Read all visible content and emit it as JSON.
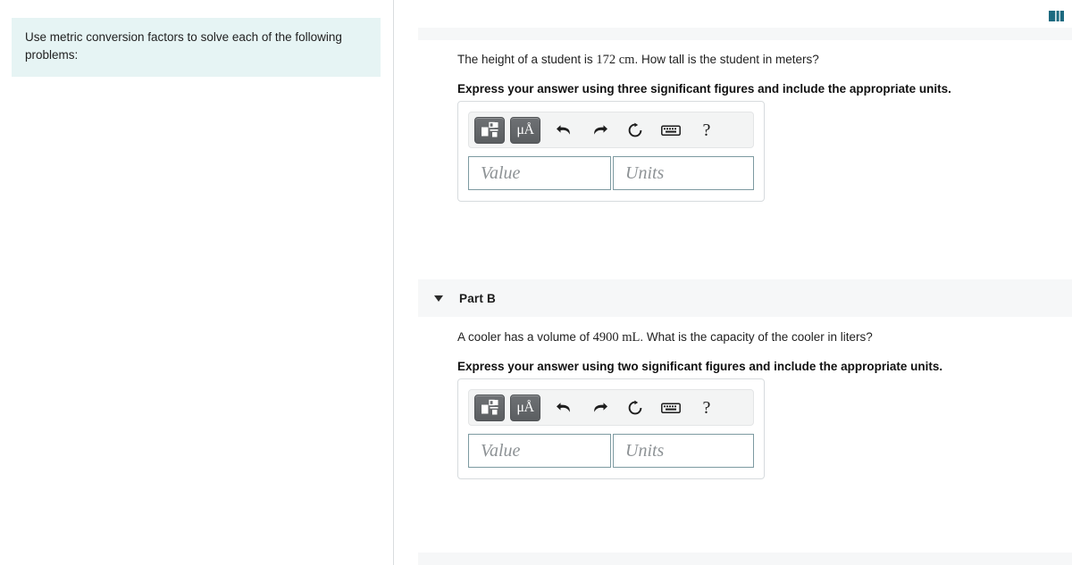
{
  "left_pane": {
    "prompt": "Use metric conversion factors to solve each of the following problems:"
  },
  "corner": {
    "icon": "panel-layout-icon",
    "color": "#1d6a80"
  },
  "parts": [
    {
      "id": "part-a",
      "header_label": "",
      "has_header": false,
      "question": "The height of a student is 172 cm. How tall is the student in meters?",
      "question_lead": "The height of a student is",
      "question_math": "172 cm",
      "question_tail": ". How tall is the student in meters?",
      "instruction": "Express your answer using three significant figures and include the appropriate units.",
      "answer": {
        "toolbar": [
          {
            "name": "template-formula-icon",
            "label": "",
            "type": "button-dark"
          },
          {
            "name": "units-micro-angstrom-icon",
            "label": "μÅ",
            "type": "button-dark"
          },
          {
            "name": "undo-icon",
            "label": "",
            "type": "icon"
          },
          {
            "name": "redo-icon",
            "label": "",
            "type": "icon"
          },
          {
            "name": "reset-icon",
            "label": "",
            "type": "icon"
          },
          {
            "name": "keyboard-icon",
            "label": "",
            "type": "icon"
          },
          {
            "name": "help-icon",
            "label": "?",
            "type": "icon"
          }
        ],
        "value_placeholder": "Value",
        "units_placeholder": "Units",
        "value": "",
        "units": ""
      }
    },
    {
      "id": "part-b",
      "header_label": "Part B",
      "has_header": true,
      "question": "A cooler has a volume of 4900 mL. What is the capacity of the cooler in liters?",
      "question_lead": "A cooler has a volume of",
      "question_math": "4900 mL",
      "question_tail": ". What is the capacity of the cooler in liters?",
      "instruction": "Express your answer using two significant figures and include the appropriate units.",
      "answer": {
        "toolbar": [
          {
            "name": "template-formula-icon",
            "label": "",
            "type": "button-dark"
          },
          {
            "name": "units-micro-angstrom-icon",
            "label": "μÅ",
            "type": "button-dark"
          },
          {
            "name": "undo-icon",
            "label": "",
            "type": "icon"
          },
          {
            "name": "redo-icon",
            "label": "",
            "type": "icon"
          },
          {
            "name": "reset-icon",
            "label": "",
            "type": "icon"
          },
          {
            "name": "keyboard-icon",
            "label": "",
            "type": "icon"
          },
          {
            "name": "help-icon",
            "label": "?",
            "type": "icon"
          }
        ],
        "value_placeholder": "Value",
        "units_placeholder": "Units",
        "value": "",
        "units": ""
      }
    }
  ],
  "colors": {
    "prompt_bg": "#e6f4f4",
    "band_bg": "#f6f7f8",
    "field_border": "#7d9aa1",
    "toolbar_button": "#626568"
  }
}
